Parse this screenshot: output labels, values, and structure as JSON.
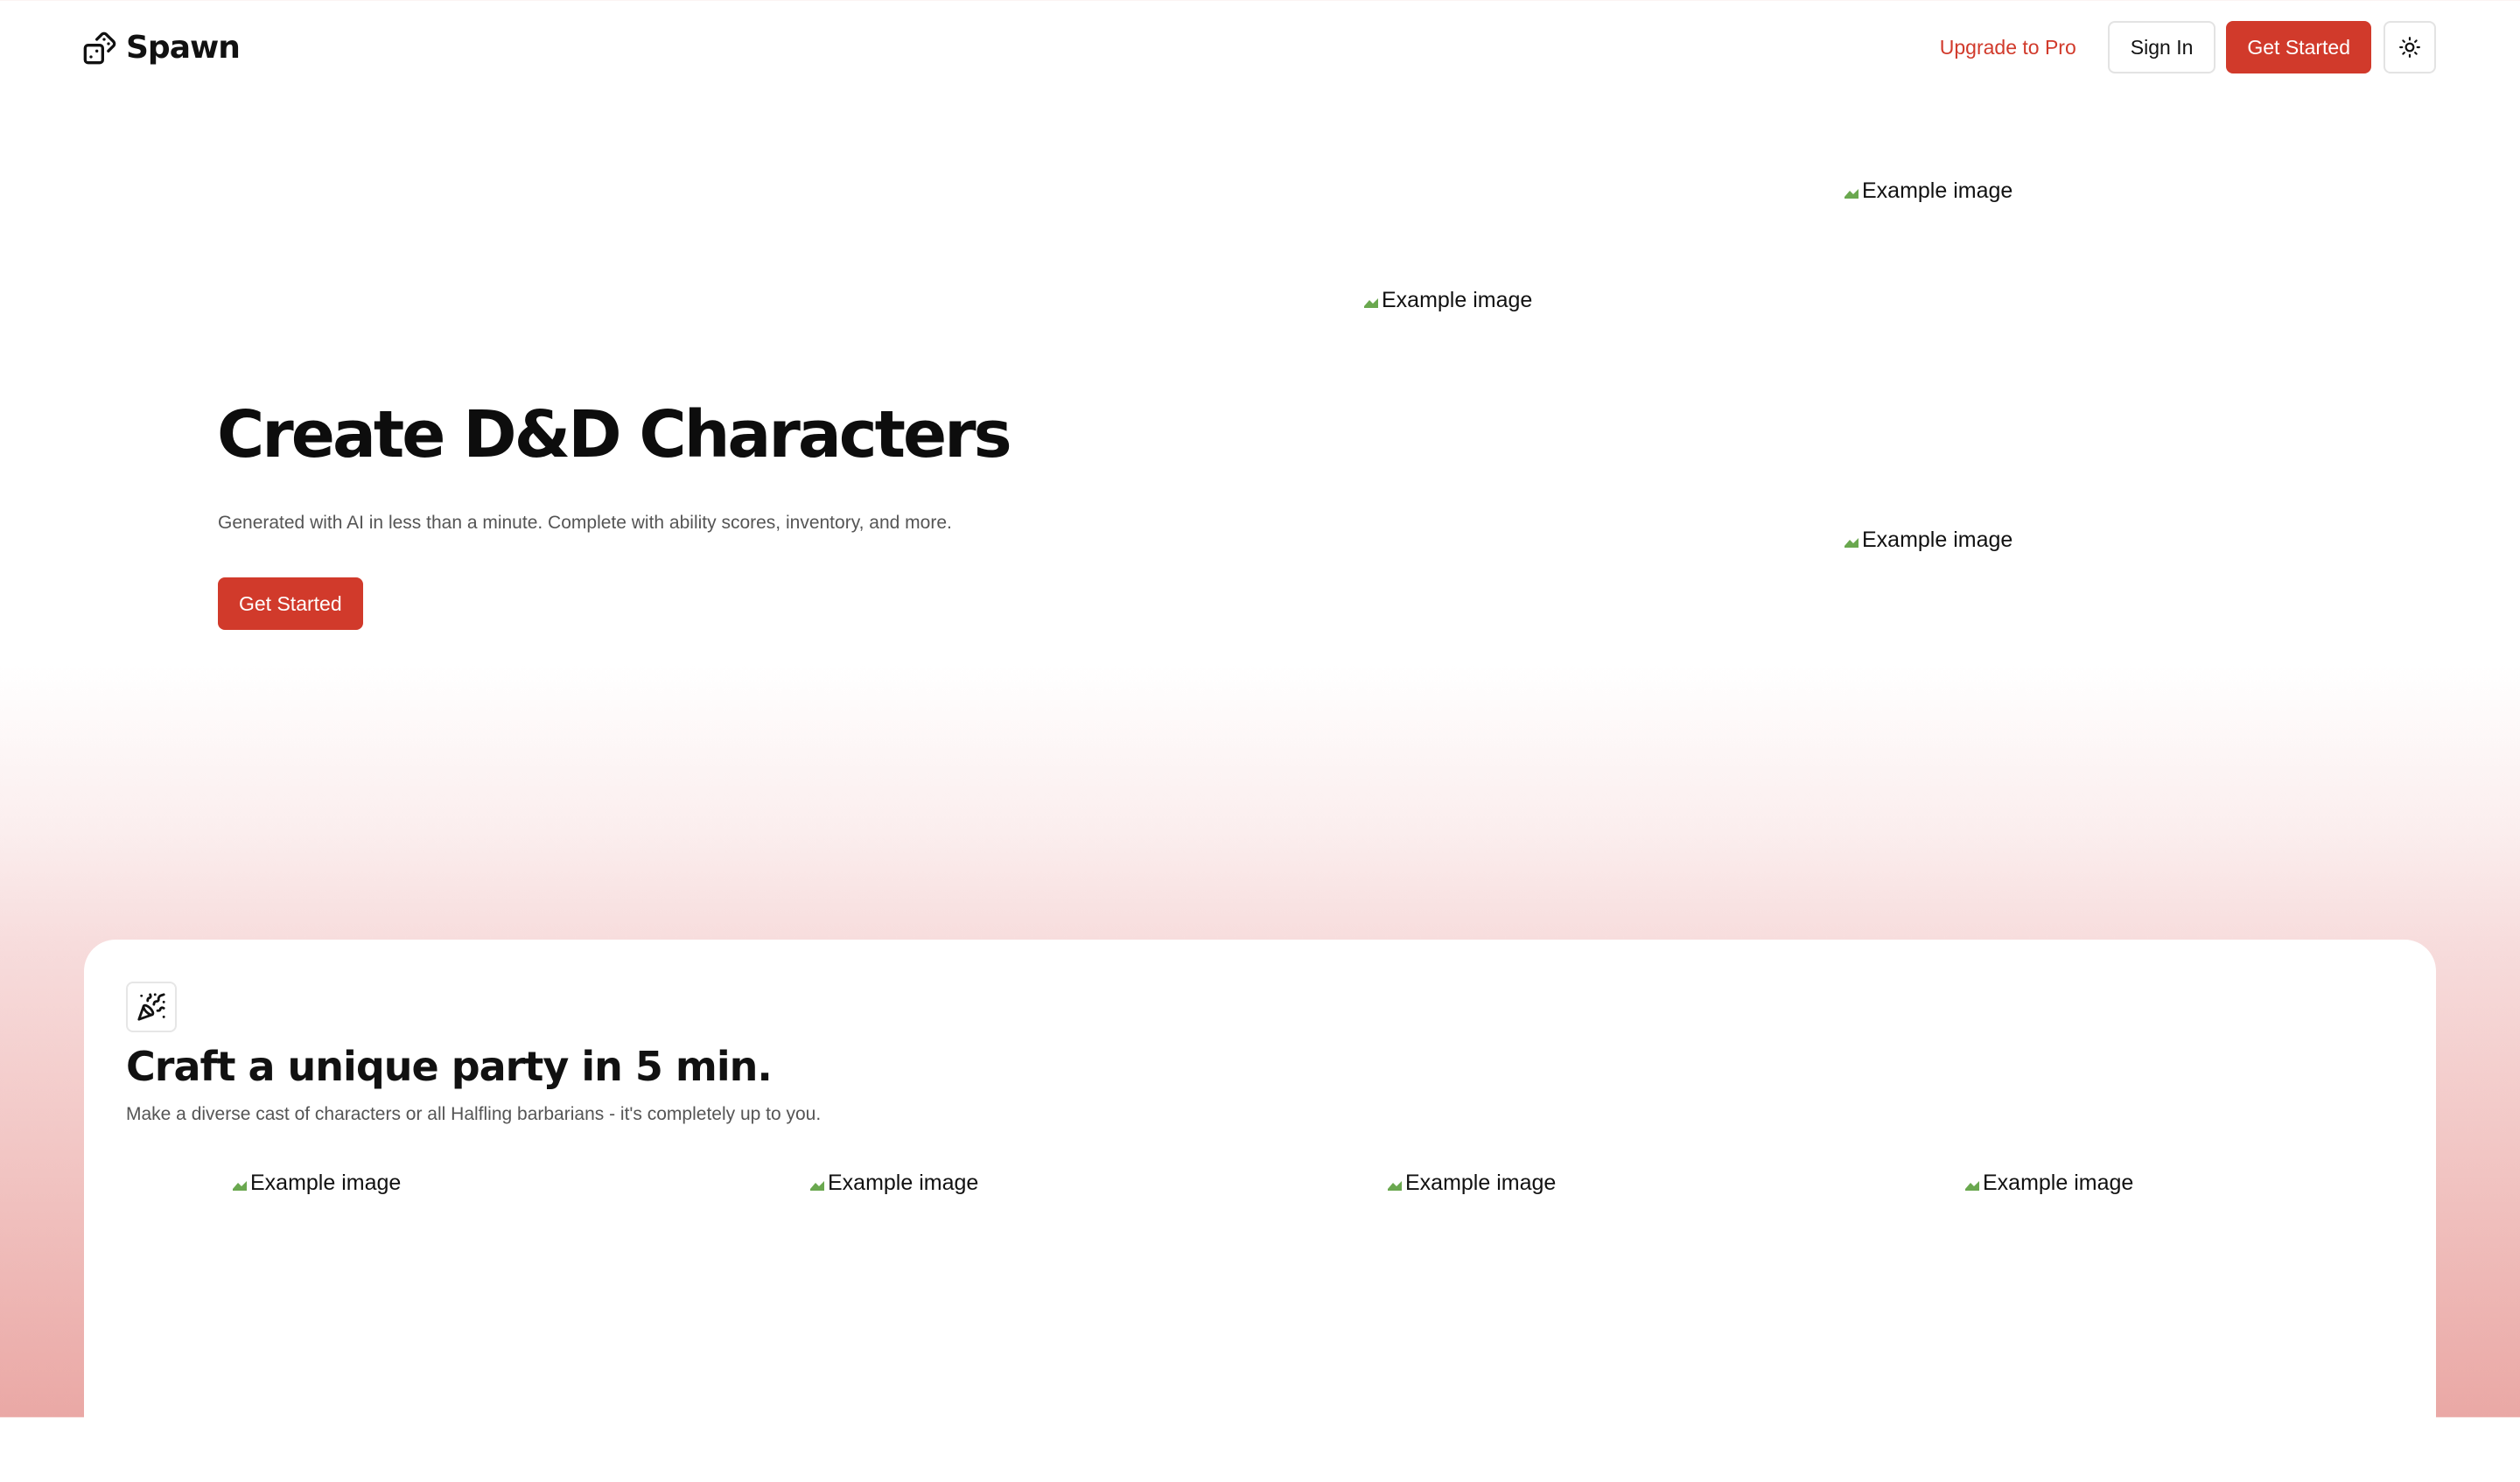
{
  "header": {
    "brand_name": "Spawn",
    "brand_icon": "dice-icon",
    "nav": {
      "upgrade_label": "Upgrade to Pro",
      "signin_label": "Sign In",
      "get_started_label": "Get Started",
      "theme_toggle_icon": "sun-icon"
    }
  },
  "hero": {
    "title": "Create D&D Characters",
    "subtitle": "Generated with AI in less than a minute. Complete with ability scores, inventory, and more.",
    "cta_label": "Get Started",
    "images": [
      {
        "alt": "Example image"
      },
      {
        "alt": "Example image"
      },
      {
        "alt": "Example image"
      }
    ]
  },
  "feature": {
    "icon": "party-popper-icon",
    "title": "Craft a unique party in 5 min.",
    "subtitle": "Make a diverse cast of characters or all Halfling barbarians - it's completely up to you.",
    "images": [
      {
        "alt": "Example image"
      },
      {
        "alt": "Example image"
      },
      {
        "alt": "Example image"
      },
      {
        "alt": "Example image"
      }
    ]
  },
  "colors": {
    "accent": "#d13a2b",
    "text": "#111111",
    "muted_text": "#555555",
    "border": "#e3e3e3",
    "gradient_bottom": "#eaa8a5"
  }
}
